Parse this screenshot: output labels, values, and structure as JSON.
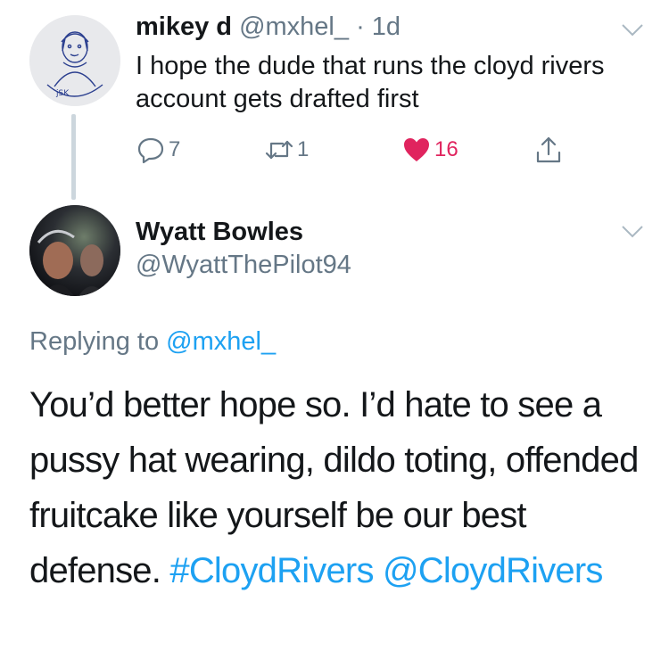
{
  "parent_tweet": {
    "name": "mikey d",
    "handle": "@mxhel_",
    "separator": "·",
    "time": "1d",
    "text": "I hope the dude that runs the cloyd rivers account gets drafted first",
    "actions": {
      "reply_count": "7",
      "retweet_count": "1",
      "like_count": "16"
    },
    "avatar_icon": "sketch-avatar-icon",
    "colors": {
      "like": "#e0245e",
      "meta": "#657786"
    }
  },
  "reply_tweet": {
    "name": "Wyatt Bowles",
    "handle": "@WyattThePilot94",
    "replying_label": "Replying to",
    "replying_handle": "@mxhel_",
    "text_plain": "You’d better hope so. I’d hate to see a pussy hat wearing, dildo toting, offended fruitcake like yourself be our best defense.",
    "hashtag": "#CloydRivers",
    "mention": "@CloydRivers",
    "avatar_icon": "photo-avatar-icon",
    "colors": {
      "link": "#1da1f2"
    }
  }
}
